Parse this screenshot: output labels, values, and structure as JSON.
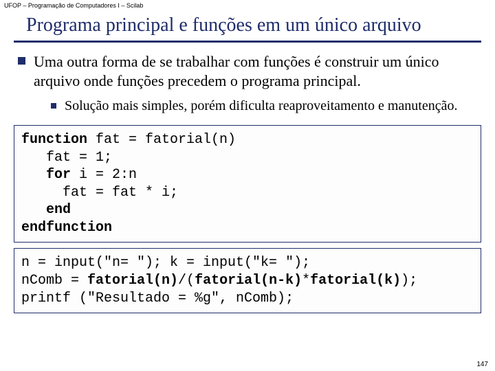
{
  "header": "UFOP – Programação de Computadores I – Scilab",
  "title": "Programa principal e funções em um único arquivo",
  "bullets": {
    "main": "Uma outra forma de se trabalhar com funções é construir um único arquivo onde funções precedem o programa principal.",
    "sub": "Solução mais simples, porém dificulta reaproveitamento e manutenção."
  },
  "code1": {
    "l1a": "function",
    "l1b": " fat = fatorial(n)",
    "l2": "   fat = 1;",
    "l3a": "   ",
    "l3b": "for",
    "l3c": " i = 2:n",
    "l4": "     fat = fat * i;",
    "l5a": "   ",
    "l5b": "end",
    "l6": "endfunction"
  },
  "code2": {
    "l1": "n = input(\"n= \"); k = input(\"k= \");",
    "l2a": "nComb = ",
    "l2b": "fatorial(n)",
    "l2c": "/(",
    "l2d": "fatorial(n-k)",
    "l2e": "*",
    "l2f": "fatorial(k)",
    "l2g": ");",
    "l3": "printf (\"Resultado = %g\", nComb);"
  },
  "page": "147"
}
